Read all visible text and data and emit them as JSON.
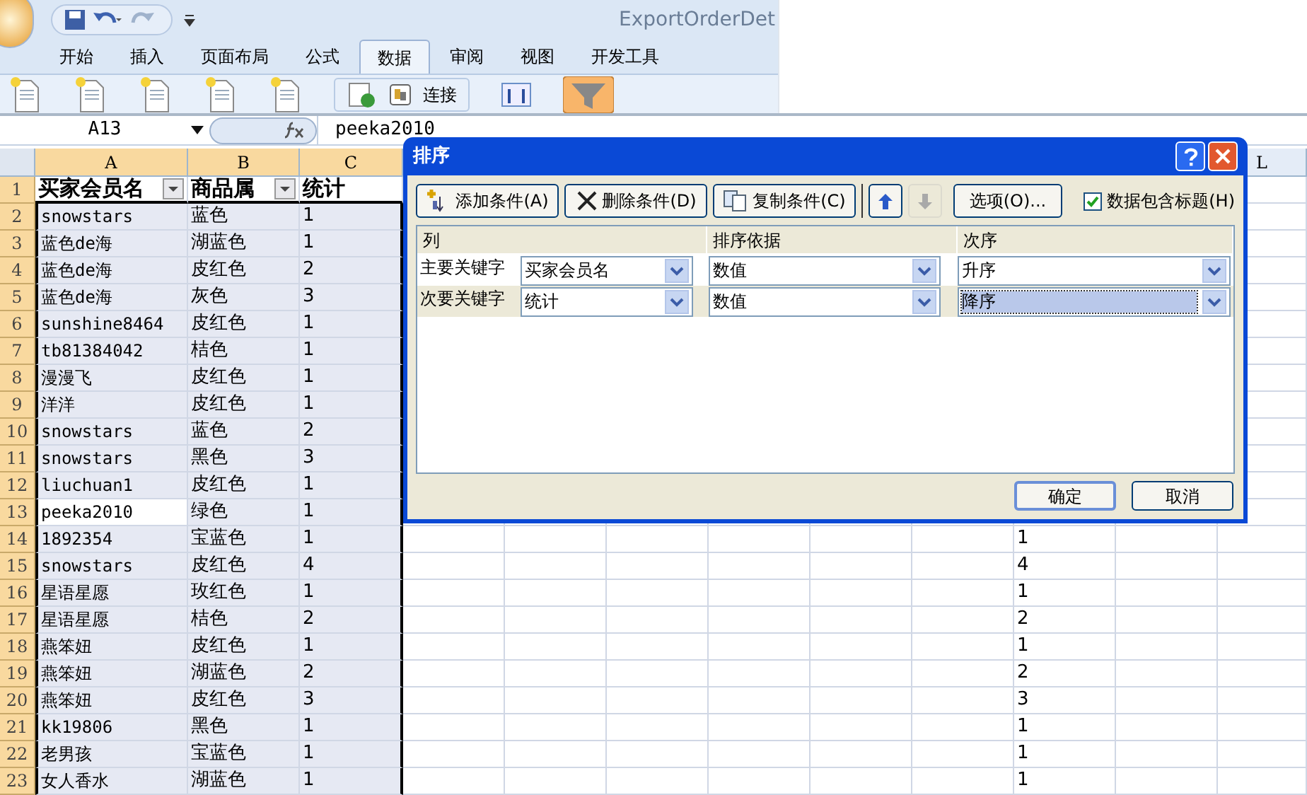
{
  "window": {
    "title": "ExportOrderDet"
  },
  "tabs": [
    {
      "label": "开始",
      "selected": false
    },
    {
      "label": "插入",
      "selected": false
    },
    {
      "label": "页面布局",
      "selected": false
    },
    {
      "label": "公式",
      "selected": false
    },
    {
      "label": "数据",
      "selected": true
    },
    {
      "label": "审阅",
      "selected": false
    },
    {
      "label": "视图",
      "selected": false
    },
    {
      "label": "开发工具",
      "selected": false
    }
  ],
  "ribbon": {
    "connection_label": "连接",
    "filter_on": true
  },
  "formula_bar": {
    "name_box": "A13",
    "formula": "peeka2010"
  },
  "sheet": {
    "columns": [
      {
        "label": "A",
        "selected": true
      },
      {
        "label": "B",
        "selected": true
      },
      {
        "label": "C",
        "selected": true
      },
      {
        "label": "L",
        "selected": false
      }
    ],
    "rows": [
      {
        "number": "1",
        "kind": "header",
        "cells": [
          "买家会员名",
          "商品属",
          "统计"
        ],
        "active": false
      },
      {
        "number": "2",
        "kind": "data",
        "cells": [
          "snowstars",
          "蓝色",
          "1"
        ],
        "active": false
      },
      {
        "number": "3",
        "kind": "data",
        "cells": [
          "蓝色de海",
          "湖蓝色",
          "1"
        ],
        "active": false
      },
      {
        "number": "4",
        "kind": "data",
        "cells": [
          "蓝色de海",
          "皮红色",
          "2"
        ],
        "active": false
      },
      {
        "number": "5",
        "kind": "data",
        "cells": [
          "蓝色de海",
          "灰色",
          "3"
        ],
        "active": false
      },
      {
        "number": "6",
        "kind": "data",
        "cells": [
          "sunshine8464",
          "皮红色",
          "1"
        ],
        "active": false
      },
      {
        "number": "7",
        "kind": "data",
        "cells": [
          "tb81384042",
          "桔色",
          "1"
        ],
        "active": false
      },
      {
        "number": "8",
        "kind": "data",
        "cells": [
          "漫漫飞",
          "皮红色",
          "1"
        ],
        "active": false
      },
      {
        "number": "9",
        "kind": "data",
        "cells": [
          "洋洋",
          "皮红色",
          "1"
        ],
        "active": false
      },
      {
        "number": "10",
        "kind": "data",
        "cells": [
          "snowstars",
          "蓝色",
          "2"
        ],
        "active": false
      },
      {
        "number": "11",
        "kind": "data",
        "cells": [
          "snowstars",
          "黑色",
          "3"
        ],
        "active": false
      },
      {
        "number": "12",
        "kind": "data",
        "cells": [
          "liuchuan1",
          "皮红色",
          "1"
        ],
        "active": false
      },
      {
        "number": "13",
        "kind": "data",
        "cells": [
          "peeka2010",
          "绿色",
          "1"
        ],
        "active": true
      },
      {
        "number": "14",
        "kind": "data",
        "cells": [
          "1892354",
          "宝蓝色",
          "1"
        ],
        "active": false,
        "column_j": "1"
      },
      {
        "number": "15",
        "kind": "data",
        "cells": [
          "snowstars",
          "皮红色",
          "4"
        ],
        "active": false,
        "column_j": "4"
      },
      {
        "number": "16",
        "kind": "data",
        "cells": [
          "星语星愿",
          "玫红色",
          "1"
        ],
        "active": false,
        "column_j": "1"
      },
      {
        "number": "17",
        "kind": "data",
        "cells": [
          "星语星愿",
          "桔色",
          "2"
        ],
        "active": false,
        "column_j": "2"
      },
      {
        "number": "18",
        "kind": "data",
        "cells": [
          "燕笨妞",
          "皮红色",
          "1"
        ],
        "active": false,
        "column_j": "1"
      },
      {
        "number": "19",
        "kind": "data",
        "cells": [
          "燕笨妞",
          "湖蓝色",
          "2"
        ],
        "active": false,
        "column_j": "2"
      },
      {
        "number": "20",
        "kind": "data",
        "cells": [
          "燕笨妞",
          "皮红色",
          "3"
        ],
        "active": false,
        "column_j": "3"
      },
      {
        "number": "21",
        "kind": "data",
        "cells": [
          "kk19806",
          "黑色",
          "1"
        ],
        "active": false,
        "column_j": "1"
      },
      {
        "number": "22",
        "kind": "data",
        "cells": [
          "老男孩",
          "宝蓝色",
          "1"
        ],
        "active": false,
        "column_j": "1"
      },
      {
        "number": "23",
        "kind": "data",
        "cells": [
          "女人香水",
          "湖蓝色",
          "1"
        ],
        "active": false,
        "column_j": "1"
      }
    ]
  },
  "dialog": {
    "title": "排序",
    "toolbar": [
      {
        "label": "添加条件(A)",
        "kind": "add"
      },
      {
        "label": "删除条件(D)",
        "kind": "delete"
      },
      {
        "label": "复制条件(C)",
        "kind": "copy"
      }
    ],
    "move_up": {
      "disabled": false
    },
    "move_down": {
      "disabled": true
    },
    "options_button": "选项(O)...",
    "has_headers": {
      "label": "数据包含标题(H)",
      "checked": true
    },
    "columns": [
      "列",
      "排序依据",
      "次序"
    ],
    "levels": [
      {
        "label": "主要关键字",
        "column": "买家会员名",
        "sort_on": "数值",
        "order": "升序",
        "selected": false
      },
      {
        "label": "次要关键字",
        "column": "统计",
        "sort_on": "数值",
        "order": "降序",
        "selected": true
      }
    ],
    "buttons": [
      "确定",
      "取消"
    ]
  }
}
